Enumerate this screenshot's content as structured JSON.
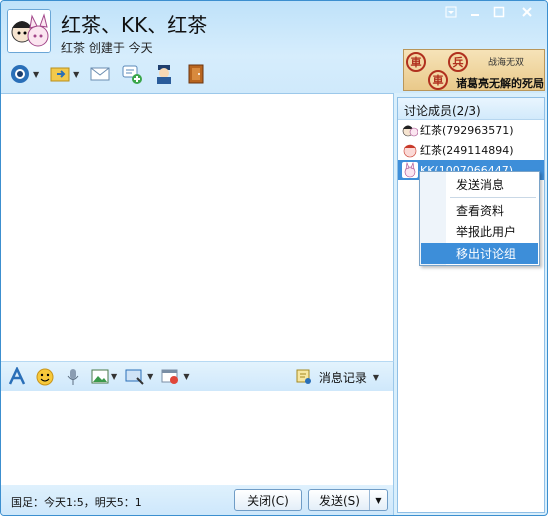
{
  "window": {
    "title": "红茶、KK、红茶",
    "subtitle": "红茶 创建于 今天"
  },
  "toolbar": {
    "items": [
      {
        "icon": "video-camera-icon",
        "has_dropdown": true
      },
      {
        "icon": "file-transfer-icon",
        "has_dropdown": true
      },
      {
        "icon": "mail-icon",
        "has_dropdown": false
      },
      {
        "icon": "message-add-icon",
        "has_dropdown": false
      },
      {
        "icon": "police-icon",
        "has_dropdown": false
      },
      {
        "icon": "door-exit-icon",
        "has_dropdown": false
      }
    ]
  },
  "ad": {
    "chess_pieces": [
      "車",
      "兵",
      "車"
    ],
    "tag": "战海无双",
    "headline": "诸葛亮无解的死局"
  },
  "members_panel": {
    "header": "讨论成员(2/3)",
    "members": [
      {
        "name": "红茶(792963571)",
        "selected": false
      },
      {
        "name": "红茶(249114894)",
        "selected": false
      },
      {
        "name": "KK(1007066447)",
        "selected": true
      }
    ]
  },
  "context_menu": {
    "items": [
      {
        "label": "发送消息",
        "active": false
      },
      {
        "label": "查看资料",
        "active": false
      },
      {
        "label": "举报此用户",
        "active": false
      },
      {
        "label": "移出讨论组",
        "active": true
      }
    ]
  },
  "input_toolbar": {
    "history_label": "消息记录"
  },
  "bottom": {
    "status": "国足：今天1:5，明天5：1",
    "close_label": "关闭(C)",
    "send_label": "发送(S)"
  },
  "colors": {
    "accent": "#3d8ed9",
    "border": "#3c8fcf",
    "header_bg": "#cfe9fb"
  }
}
